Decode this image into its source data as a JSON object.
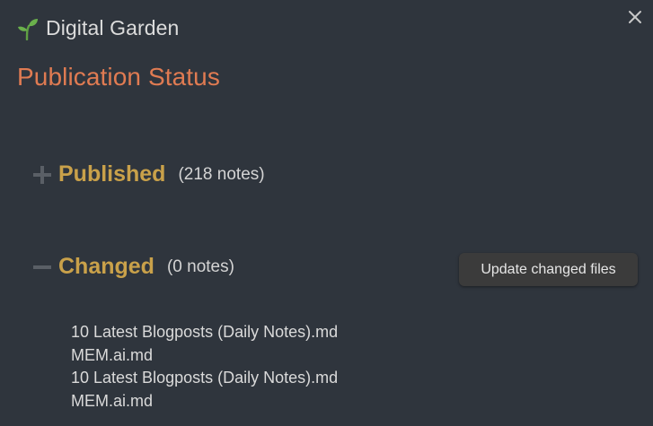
{
  "app": {
    "title": "Digital Garden",
    "icon": "sprout-icon",
    "close_icon": "close-icon"
  },
  "page": {
    "title": "Publication Status"
  },
  "sections": {
    "published": {
      "toggle_icon": "plus-icon",
      "title": "Published",
      "count": "(218 notes)",
      "expanded": false
    },
    "changed": {
      "toggle_icon": "minus-icon",
      "title": "Changed",
      "count": "(0 notes)",
      "expanded": true,
      "action_label": "Update changed files",
      "files": [
        "10 Latest Blogposts (Daily Notes).md",
        "MEM.ai.md",
        "10 Latest Blogposts (Daily Notes).md",
        "MEM.ai.md"
      ]
    }
  },
  "colors": {
    "background": "#2f353d",
    "accent_title": "#e07b52",
    "section_heading": "#c9a14a",
    "sprout_green": "#6ab04c",
    "button_bg": "#3b3b3b"
  }
}
